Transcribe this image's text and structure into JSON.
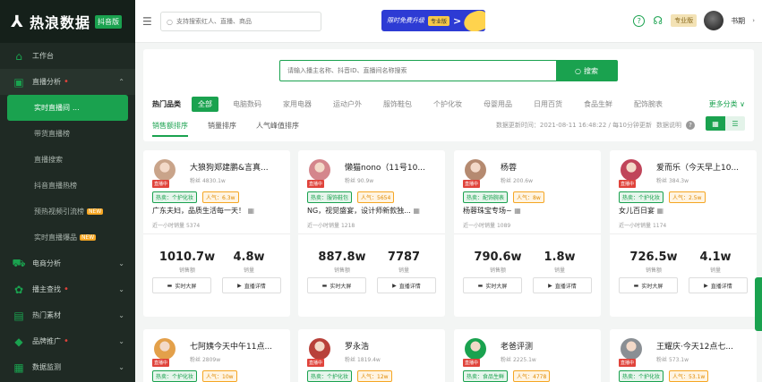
{
  "brand": {
    "name": "热浪数据",
    "badge": "抖音版"
  },
  "sidebar": {
    "items": [
      {
        "label": "工作台",
        "icon": "home-icon",
        "sym": "⌂"
      },
      {
        "label": "直播分析",
        "icon": "live-icon",
        "sym": "▣",
        "dot": "•",
        "chev": "⌃"
      },
      {
        "label": "电商分析",
        "icon": "cart-icon",
        "sym": "⛟",
        "chev": "⌄"
      },
      {
        "label": "播主查找",
        "icon": "find-icon",
        "sym": "✿",
        "dot": "•",
        "chev": "⌄"
      },
      {
        "label": "热门素材",
        "icon": "material-icon",
        "sym": "▤",
        "chev": "⌄"
      },
      {
        "label": "品牌推广",
        "icon": "brand-icon",
        "sym": "◆",
        "dot": "•",
        "chev": "⌄"
      },
      {
        "label": "数据监测",
        "icon": "monitor-icon",
        "sym": "▦",
        "chev": "⌄"
      }
    ],
    "sub": [
      {
        "label": "实时直播间",
        "extra": "...",
        "active": true
      },
      {
        "label": "带货直播榜"
      },
      {
        "label": "直播搜索"
      },
      {
        "label": "抖音直播热榜"
      },
      {
        "label": "预热视频引流榜",
        "tag": "NEW"
      },
      {
        "label": "实时直播爆品",
        "tag": "NEW"
      }
    ]
  },
  "header": {
    "search_placeholder": "支持搜索红人、直播、商品",
    "banner": {
      "text": "限时免费升级",
      "badge": "专业版",
      "arrow": ">"
    },
    "help_icon": "?",
    "support_icon": "☊",
    "pro_badge": "专业版",
    "user": "书期",
    "caret": "›"
  },
  "main": {
    "search_placeholder": "请输入播主名称、抖音ID、直播间名称搜索",
    "search_button": "搜索",
    "cat_label": "热门品类",
    "categories": [
      "全部",
      "电脑数码",
      "家用电器",
      "运动户外",
      "服饰鞋包",
      "个护化妆",
      "母婴用品",
      "日用百货",
      "食品生鲜",
      "配饰腕表"
    ],
    "more": "更多分类 ∨",
    "sorts": [
      "销售额排序",
      "销量排序",
      "人气峰值排序"
    ],
    "update_text": "数据更新时间：2021-08-11 16:48:22 / 每10分钟更新",
    "explain": "数据说明",
    "colors": {
      "accent": "#1aa24f",
      "live": "#e0433b",
      "tag_orange": "#f5a623"
    }
  },
  "card_labels": {
    "live": "直播中",
    "fans_prefix": "粉丝",
    "hot_prefix": "热卖：",
    "pop_prefix": "人气：",
    "hour_sales": "近一小时销量",
    "sales_amount": "销售额",
    "sales_count": "销量",
    "btn_screen": "实时大屏",
    "btn_detail": "直播详情"
  },
  "cards": [
    {
      "name": "大狼狗郑建鹏&言真...",
      "fans": "4830.1w",
      "hot": "个护化妆",
      "pop": "6.3w",
      "title": "广东夫妇，品质生活每一天！",
      "hour": "5374",
      "amount": "1010.7w",
      "count": "4.8w",
      "avatar_color": "#c9a48a"
    },
    {
      "name": "懒猫nono（11号10...",
      "fans": "90.9w",
      "hot": "服饰鞋包",
      "pop": "5654",
      "title": "NG，视觉盛宴，设计师新款独...",
      "hour": "1218",
      "amount": "887.8w",
      "count": "7787",
      "avatar_color": "#d4868c"
    },
    {
      "name": "杨蓉",
      "fans": "200.6w",
      "hot": "配饰腕表",
      "pop": "8w",
      "title": "杨蓉珠宝专场~",
      "hour": "1089",
      "amount": "790.6w",
      "count": "1.8w",
      "avatar_color": "#b58a70"
    },
    {
      "name": "爱而乐（今天早上10...",
      "fans": "384.3w",
      "hot": "个护化妆",
      "pop": "2.5w",
      "title": "女儿百日宴",
      "hour": "1174",
      "amount": "726.5w",
      "count": "4.1w",
      "avatar_color": "#c0455a"
    },
    {
      "name": "七阿姨今天中午11点...",
      "fans": "2809w",
      "hot": "个护化妆",
      "pop": "10w",
      "avatar_color": "#e3a04a"
    },
    {
      "name": "罗永浩",
      "fans": "1819.4w",
      "hot": "个护化妆",
      "pop": "12w",
      "avatar_color": "#b8413a"
    },
    {
      "name": "老爸评测",
      "fans": "2225.1w",
      "hot": "食品生鲜",
      "pop": "4778",
      "avatar_color": "#1aa24f"
    },
    {
      "name": "王耀庆·今天12点七...",
      "fans": "573.1w",
      "hot": "个护化妆",
      "pop": "53.1w",
      "avatar_color": "#8a8f94"
    }
  ]
}
